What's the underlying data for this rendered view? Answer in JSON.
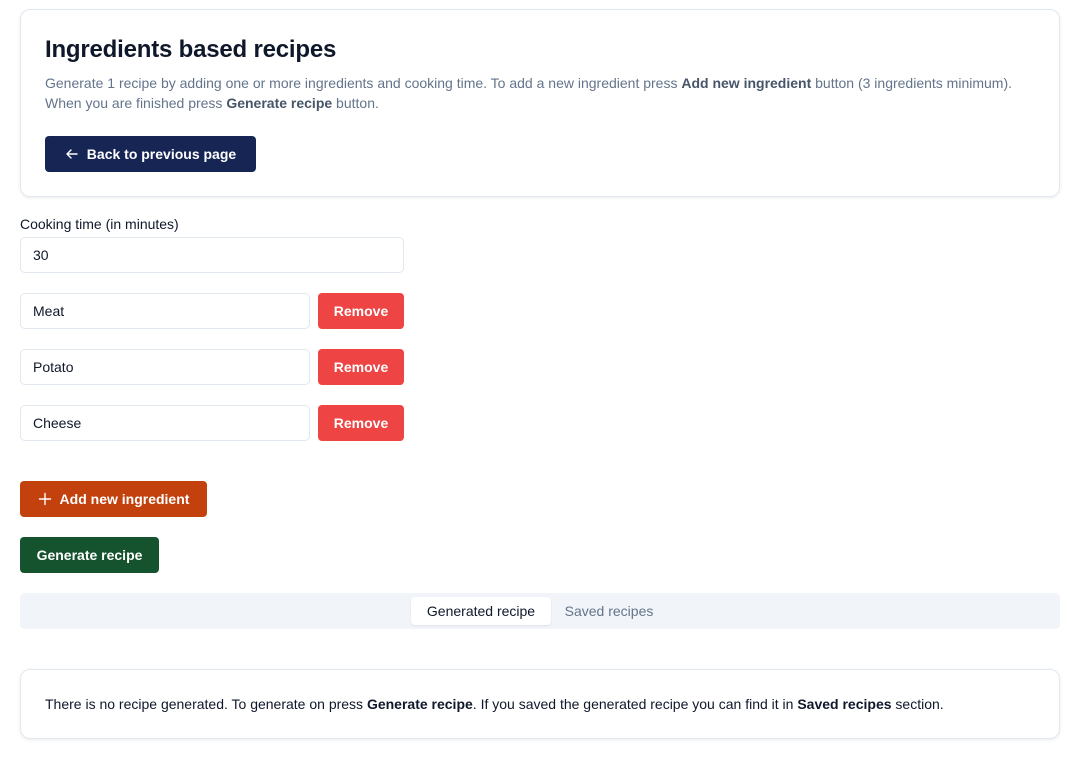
{
  "header": {
    "title": "Ingredients based recipes",
    "desc_1": "Generate 1 recipe by adding one or more ingredients and cooking time. To add a new ingredient press ",
    "desc_bold_1": "Add new ingredient",
    "desc_2": " button (3 ingredients minimum). When you are finished press ",
    "desc_bold_2": "Generate recipe",
    "desc_3": " button.",
    "back_label": "Back to previous page",
    "back_icon": "arrow-left-icon"
  },
  "form": {
    "cooking_time_label": "Cooking time (in minutes)",
    "cooking_time_value": "30",
    "ingredients": [
      {
        "value": "Meat",
        "remove_label": "Remove"
      },
      {
        "value": "Potato",
        "remove_label": "Remove"
      },
      {
        "value": "Cheese",
        "remove_label": "Remove"
      }
    ],
    "add_label": "Add new ingredient",
    "add_icon": "plus-icon",
    "generate_label": "Generate recipe"
  },
  "tabs": [
    {
      "label": "Generated recipe",
      "active": true
    },
    {
      "label": "Saved recipes",
      "active": false
    }
  ],
  "result": {
    "text_1": "There is no recipe generated. To generate on press ",
    "bold_1": "Generate recipe",
    "text_2": ". If you saved the generated recipe you can find it in ",
    "bold_2": "Saved recipes",
    "text_3": " section."
  },
  "colors": {
    "back_button": "#172554",
    "remove_button": "#ef4444",
    "add_button": "#c2410c",
    "generate_button": "#14532d"
  }
}
